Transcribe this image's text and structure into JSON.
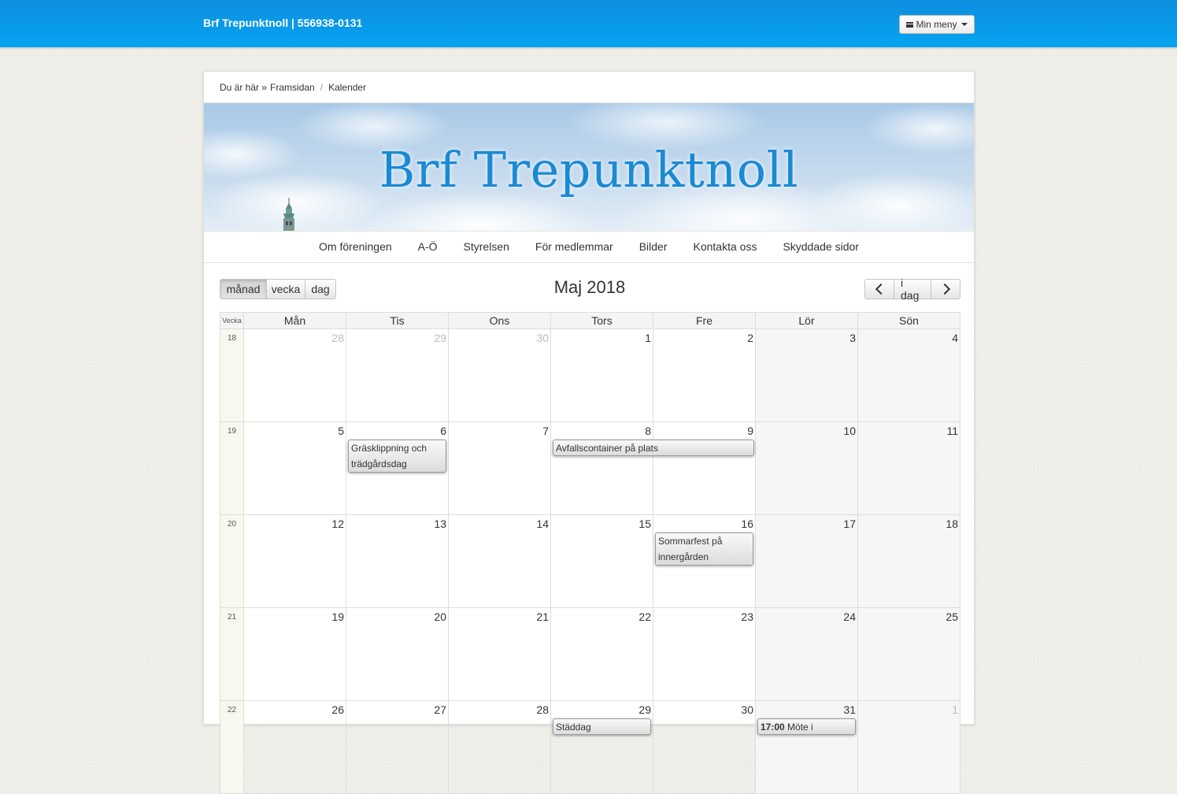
{
  "header": {
    "brand": "Brf Trepunktnoll | 556938-0131",
    "menu_label": "Min meny"
  },
  "breadcrumb": {
    "prefix": "Du är här »",
    "items": [
      "Framsidan",
      "Kalender"
    ]
  },
  "banner": {
    "title": "Brf Trepunktnoll"
  },
  "nav": {
    "items": [
      "Om föreningen",
      "A-Ö",
      "Styrelsen",
      "För medlemmar",
      "Bilder",
      "Kontakta oss",
      "Skyddade sidor"
    ]
  },
  "calendar": {
    "title": "Maj 2018",
    "views": [
      "månad",
      "vecka",
      "dag"
    ],
    "active_view": "månad",
    "today_label": "i dag",
    "week_header": "Vecka",
    "day_headers": [
      "Mån",
      "Tis",
      "Ons",
      "Tors",
      "Fre",
      "Lör",
      "Sön"
    ],
    "weeks": [
      {
        "week": "18",
        "days": [
          "28",
          "29",
          "30",
          "1",
          "2",
          "3",
          "4"
        ]
      },
      {
        "week": "19",
        "days": [
          "5",
          "6",
          "7",
          "8",
          "9",
          "10",
          "11"
        ]
      },
      {
        "week": "20",
        "days": [
          "12",
          "13",
          "14",
          "15",
          "16",
          "17",
          "18"
        ]
      },
      {
        "week": "21",
        "days": [
          "19",
          "20",
          "21",
          "22",
          "23",
          "24",
          "25"
        ]
      },
      {
        "week": "22",
        "days": [
          "26",
          "27",
          "28",
          "29",
          "30",
          "31",
          "1"
        ]
      }
    ],
    "events": {
      "grasklippning": "Gräsklippning och trädgårdsdag",
      "avfallscontainer": "Avfallscontainer på plats",
      "sommarfest": "Sommarfest på innergården",
      "staddag": "Städdag",
      "mote_time": "17:00",
      "mote_title": "Möte i"
    }
  }
}
